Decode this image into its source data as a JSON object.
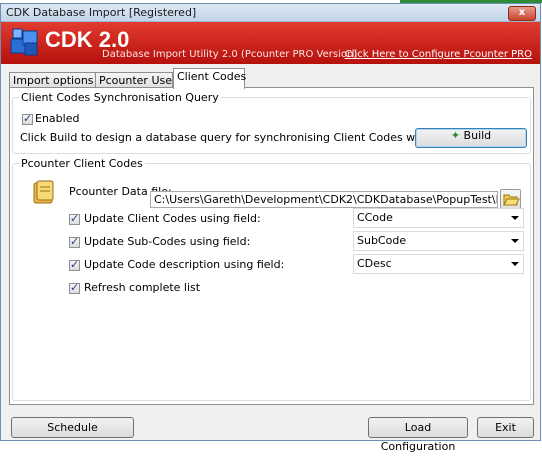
{
  "window": {
    "title": "CDK Database Import [Registered]",
    "close_glyph": "x"
  },
  "banner": {
    "product": "CDK 2.0",
    "subtitle": "Database Import Utility 2.0 (Pcounter PRO Version)",
    "config_link": "Click Here to Configure Pcounter PRO"
  },
  "tabs": [
    {
      "label": "Import options",
      "active": false
    },
    {
      "label": "Pcounter Users",
      "active": false
    },
    {
      "label": "Client Codes",
      "active": true
    }
  ],
  "sync": {
    "group_title": "Client Codes Synchronisation Query",
    "enabled_label": "Enabled",
    "enabled_checked": true,
    "description": "Click Build to design a database query for synchronising Client Codes with Pcounter",
    "build_label": "Build"
  },
  "pcounter": {
    "group_title": "Pcounter Client Codes",
    "data_file_label": "Pcounter Data file:",
    "data_file_value": "C:\\Users\\Gareth\\Development\\CDK2\\CDKDatabase\\PopupTest\\PPOPUP.DBF",
    "options": [
      {
        "label": "Update Client Codes using field:",
        "checked": true,
        "value": "CCode"
      },
      {
        "label": "Update Sub-Codes using field:",
        "checked": true,
        "value": "SubCode"
      },
      {
        "label": "Update Code description using field:",
        "checked": true,
        "value": "CDesc"
      }
    ],
    "refresh_label": "Refresh complete list",
    "refresh_checked": true
  },
  "footer": {
    "schedule_label": "Schedule",
    "load_label": "Load Configuration",
    "exit_label": "Exit"
  },
  "colors": {
    "banner": "#c8201a",
    "accent_green": "#2e8b3a"
  }
}
